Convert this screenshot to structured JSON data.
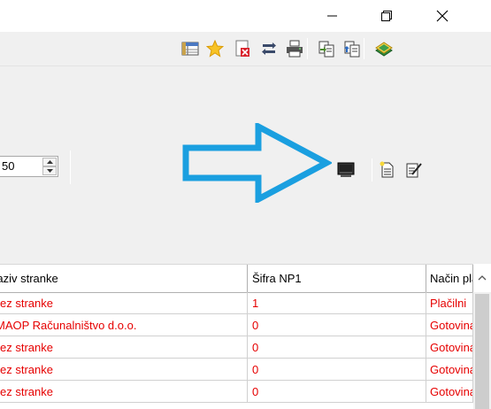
{
  "window": {
    "icons": [
      "minimize-icon",
      "restore-icon",
      "close-icon"
    ]
  },
  "toolbar": {
    "icons": [
      "grid-icon",
      "star-icon",
      "delete-document-icon",
      "refresh-icon",
      "print-icon",
      "copy-icon",
      "paste-icon",
      "book-icon"
    ]
  },
  "form": {
    "spinner_value": "50"
  },
  "actions": {
    "icons": [
      "monitor-icon",
      "new-document-icon",
      "edit-icon"
    ],
    "highlight_color": "#1a9fe0"
  },
  "grid": {
    "columns": [
      "Naziv stranke",
      "Šifra NP1",
      "Način plačila"
    ],
    "rows": [
      [
        "Brez stranke",
        "1",
        "Plačilni"
      ],
      [
        "MAOP Računalništvo d.o.o.",
        "0",
        "Gotovina"
      ],
      [
        "Brez stranke",
        "0",
        "Gotovina"
      ],
      [
        "Brez stranke",
        "0",
        "Gotovina"
      ],
      [
        "Brez stranke",
        "0",
        "Gotovina"
      ]
    ],
    "row_color": "#e60000"
  }
}
